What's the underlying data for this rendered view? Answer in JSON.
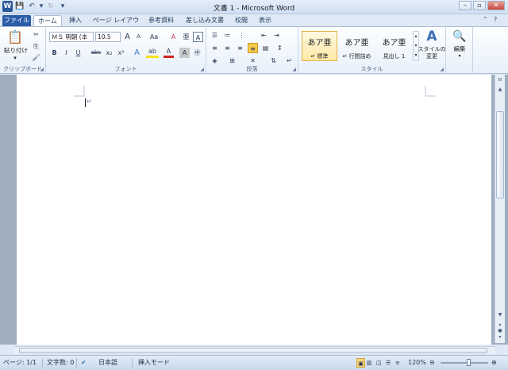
{
  "window": {
    "title": "文書 1 - Microsoft Word",
    "minimize": "–",
    "restore": "▫",
    "close": "✕"
  },
  "qat": {
    "logo": "W",
    "save": "💾",
    "undo": "↶",
    "undo_drop": "▾",
    "redo": "↻",
    "custom": "▾"
  },
  "tabs": [
    "ファイル",
    "ホーム",
    "挿入",
    "ページ レイアウト",
    "参考資料",
    "差し込み文書",
    "校閲",
    "表示"
  ],
  "tab_icons": {
    "minimize": "⌃",
    "help": "?"
  },
  "ribbon": {
    "clipboard": {
      "label": "クリップボード",
      "paste": "貼り付け",
      "paste_arrow": "▾",
      "cut": "✂",
      "copy": "⎘",
      "format_painter": "🖌",
      "paste_icon": "📋"
    },
    "font": {
      "label": "フォント",
      "font_name": "ＭＳ 明朝 (本",
      "font_size": "10.5",
      "grow": "A",
      "shrink": "A",
      "case": "Aa",
      "clear": "A",
      "ruby": "亜",
      "enclose": "字",
      "char_border": "A",
      "bold": "B",
      "italic": "I",
      "underline": "U",
      "strike": "abc",
      "sub": "x₂",
      "sup": "x²",
      "effects": "A",
      "highlight": "ab",
      "color": "A",
      "shade": "A",
      "encircle": "㊥"
    },
    "paragraph": {
      "label": "段落"
    },
    "styles": {
      "label": "スタイル",
      "items": [
        {
          "sample": "あア亜",
          "name": "標準",
          "mark": "↵"
        },
        {
          "sample": "あア亜",
          "name": "行間詰め",
          "mark": "↵"
        },
        {
          "sample": "あア亜",
          "name": "見出し 1",
          "mark": ""
        }
      ],
      "change_styles": "スタイルの",
      "change_styles2": "変更"
    },
    "editing": {
      "label": "編集"
    }
  },
  "colors": {
    "accent": "#2c5ea8",
    "highlight": "#f7e21c",
    "font_red": "#d02020",
    "ribbon_border": "#aabdd6"
  },
  "statusbar": {
    "page": "ページ: 1/1",
    "words": "文字数: 0",
    "lang": "日本語",
    "mode": "挿入モード",
    "zoom": "120%",
    "zoom_out": "⊖",
    "zoom_in": "⊕"
  },
  "scroll": {
    "up": "▲",
    "down": "▼",
    "prev": "▴",
    "next": "▾",
    "left": "◂",
    "right": "▸"
  }
}
